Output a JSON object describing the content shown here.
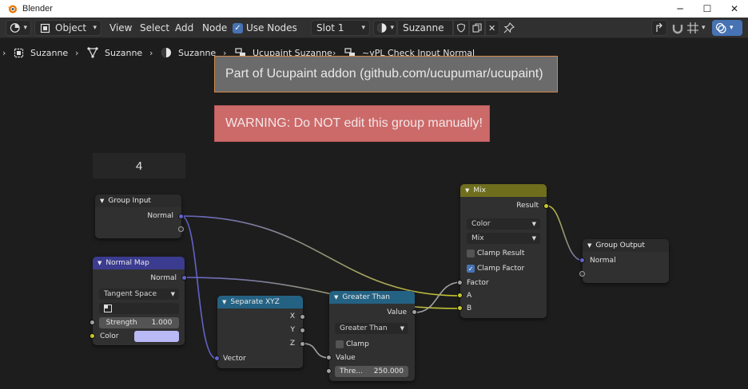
{
  "window": {
    "title": "Blender",
    "minimize": "─",
    "maximize": "☐",
    "close": "✕"
  },
  "header": {
    "mode": "Object",
    "view": "View",
    "select": "Select",
    "add": "Add",
    "node": "Node",
    "use_nodes_label": "Use Nodes",
    "use_nodes_checked": true,
    "slot": "Slot 1",
    "material": "Suzanne"
  },
  "breadcrumb": [
    "Suzanne",
    "Suzanne",
    "Suzanne",
    "Ucupaint Suzanne",
    "~yPL Check Input Normal"
  ],
  "frames": {
    "info": "Part of Ucupaint addon (github.com/ucupumar/ucupaint)",
    "warning": "WARNING: Do NOT edit this group manually!",
    "number": "4"
  },
  "nodes": {
    "group_input": {
      "title": "Group Input",
      "normal": "Normal"
    },
    "normal_map": {
      "title": "Normal Map",
      "normal": "Normal",
      "space": "Tangent Space",
      "strength_label": "Strength",
      "strength_value": "1.000",
      "color_label": "Color",
      "color_value": "#b9b9f5"
    },
    "separate_xyz": {
      "title": "Separate XYZ",
      "x": "X",
      "y": "Y",
      "z": "Z",
      "vector": "Vector"
    },
    "greater_than": {
      "title": "Greater Than",
      "value_out": "Value",
      "operation": "Greater Than",
      "clamp": "Clamp",
      "value_in": "Value",
      "threshold_label": "Thre...",
      "threshold_value": "250.000"
    },
    "mix": {
      "title": "Mix",
      "result": "Result",
      "data_type": "Color",
      "blend": "Mix",
      "clamp_result": "Clamp Result",
      "clamp_factor": "Clamp Factor",
      "clamp_result_checked": false,
      "clamp_factor_checked": true,
      "factor": "Factor",
      "a": "A",
      "b": "B"
    },
    "group_output": {
      "title": "Group Output",
      "normal": "Normal"
    }
  },
  "colors": {
    "vector_socket": "#6363c7",
    "float_socket": "#a1a1a1",
    "color_socket": "#c7c729",
    "input_header": "#2b2b2b",
    "vector_header": "#3b3b8f",
    "converter_header": "#246283",
    "color_header": "#6e6e1d",
    "info_frame": "#6b6b6b",
    "warning_frame": "#cc6a6a",
    "accent": "#4772b3"
  }
}
